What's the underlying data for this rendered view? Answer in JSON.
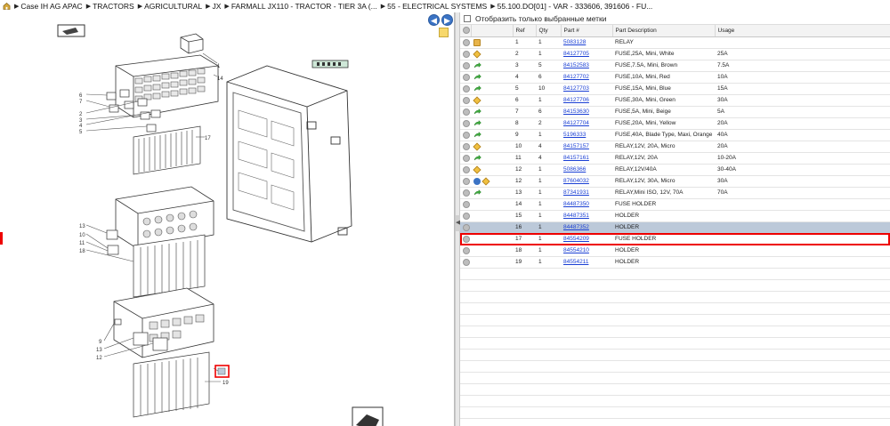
{
  "breadcrumb": [
    {
      "label": "Case IH AG APAC"
    },
    {
      "label": "TRACTORS"
    },
    {
      "label": "AGRICULTURAL"
    },
    {
      "label": "JX"
    },
    {
      "label": "FARMALL JX110 - TRACTOR - TIER 3A (..."
    },
    {
      "label": "55 - ELECTRICAL SYSTEMS"
    },
    {
      "label": "55.100.DO[01] - VAR - 333606, 391606 - FU..."
    }
  ],
  "filter": {
    "label": "Отобразить только выбранные метки",
    "checked": false
  },
  "table": {
    "headers": {
      "ref": "Ref",
      "qty": "Qty",
      "part": "Part #",
      "desc": "Part Description",
      "usage": "Usage"
    },
    "rows": [
      {
        "icons": [
          "box"
        ],
        "ref": "1",
        "qty": "1",
        "part": "5083128",
        "desc": "RELAY",
        "usage": ""
      },
      {
        "icons": [
          "cube"
        ],
        "ref": "2",
        "qty": "1",
        "part": "84127705",
        "desc": "FUSE,25A, Mini, White",
        "usage": "25A"
      },
      {
        "icons": [
          "arrow"
        ],
        "ref": "3",
        "qty": "5",
        "part": "84152583",
        "desc": "FUSE,7.5A, Mini, Brown",
        "usage": "7.5A"
      },
      {
        "icons": [
          "arrow"
        ],
        "ref": "4",
        "qty": "6",
        "part": "84127702",
        "desc": "FUSE,10A, Mini, Red",
        "usage": "10A"
      },
      {
        "icons": [
          "arrow"
        ],
        "ref": "5",
        "qty": "10",
        "part": "84127703",
        "desc": "FUSE,15A, Mini, Blue",
        "usage": "15A"
      },
      {
        "icons": [
          "cube"
        ],
        "ref": "6",
        "qty": "1",
        "part": "84127706",
        "desc": "FUSE,30A, Mini, Green",
        "usage": "30A"
      },
      {
        "icons": [
          "arrow"
        ],
        "ref": "7",
        "qty": "6",
        "part": "84153630",
        "desc": "FUSE,5A, Mini, Beige",
        "usage": "5A"
      },
      {
        "icons": [
          "arrow"
        ],
        "ref": "8",
        "qty": "2",
        "part": "84127704",
        "desc": "FUSE,20A, Mini, Yellow",
        "usage": "20A"
      },
      {
        "icons": [
          "arrow"
        ],
        "ref": "9",
        "qty": "1",
        "part": "5196333",
        "desc": "FUSE,40A, Blade Type, Maxi, Orange",
        "usage": "40A"
      },
      {
        "icons": [
          "cube"
        ],
        "ref": "10",
        "qty": "4",
        "part": "84157157",
        "desc": "RELAY,12V, 20A, Micro",
        "usage": "20A"
      },
      {
        "icons": [
          "arrow"
        ],
        "ref": "11",
        "qty": "4",
        "part": "84157161",
        "desc": "RELAY,12V, 20A",
        "usage": "10-20A"
      },
      {
        "icons": [
          "cube"
        ],
        "ref": "12",
        "qty": "1",
        "part": "5086366",
        "desc": "RELAY,12V/40A",
        "usage": "30-40A"
      },
      {
        "icons": [
          "swap",
          "cube"
        ],
        "ref": "12",
        "qty": "1",
        "part": "87604032",
        "desc": "RELAY,12V, 30A, Micro",
        "usage": "30A"
      },
      {
        "icons": [
          "arrow"
        ],
        "ref": "13",
        "qty": "1",
        "part": "87341931",
        "desc": "RELAY,Mini ISO, 12V, 70A",
        "usage": "70A"
      },
      {
        "icons": [],
        "ref": "14",
        "qty": "1",
        "part": "84487350",
        "desc": "FUSE HOLDER",
        "usage": ""
      },
      {
        "icons": [],
        "ref": "15",
        "qty": "1",
        "part": "84487351",
        "desc": "HOLDER",
        "usage": ""
      },
      {
        "icons": [],
        "ref": "16",
        "qty": "1",
        "part": "84487352",
        "desc": "HOLDER",
        "usage": "",
        "selected": true
      },
      {
        "icons": [],
        "ref": "17",
        "qty": "1",
        "part": "84554209",
        "desc": "FUSE HOLDER",
        "usage": ""
      },
      {
        "icons": [],
        "ref": "18",
        "qty": "1",
        "part": "84554210",
        "desc": "HOLDER",
        "usage": ""
      },
      {
        "icons": [],
        "ref": "19",
        "qty": "1",
        "part": "84554211",
        "desc": "HOLDER",
        "usage": ""
      }
    ]
  },
  "diagram": {
    "callouts": [
      "1",
      "14",
      "6",
      "7",
      "2",
      "3",
      "4",
      "5",
      "17",
      "13",
      "10",
      "11",
      "18",
      "9",
      "13",
      "12",
      "19"
    ]
  },
  "icons": {
    "home": "home-icon",
    "prev": "arrow-left-icon",
    "next": "arrow-right-icon",
    "note": "note-icon",
    "export": "export-icon"
  },
  "colors": {
    "selection": "#bcc9d9",
    "highlight": "#e00000",
    "link": "#1a3fd4",
    "nav": "#3b73c4"
  }
}
